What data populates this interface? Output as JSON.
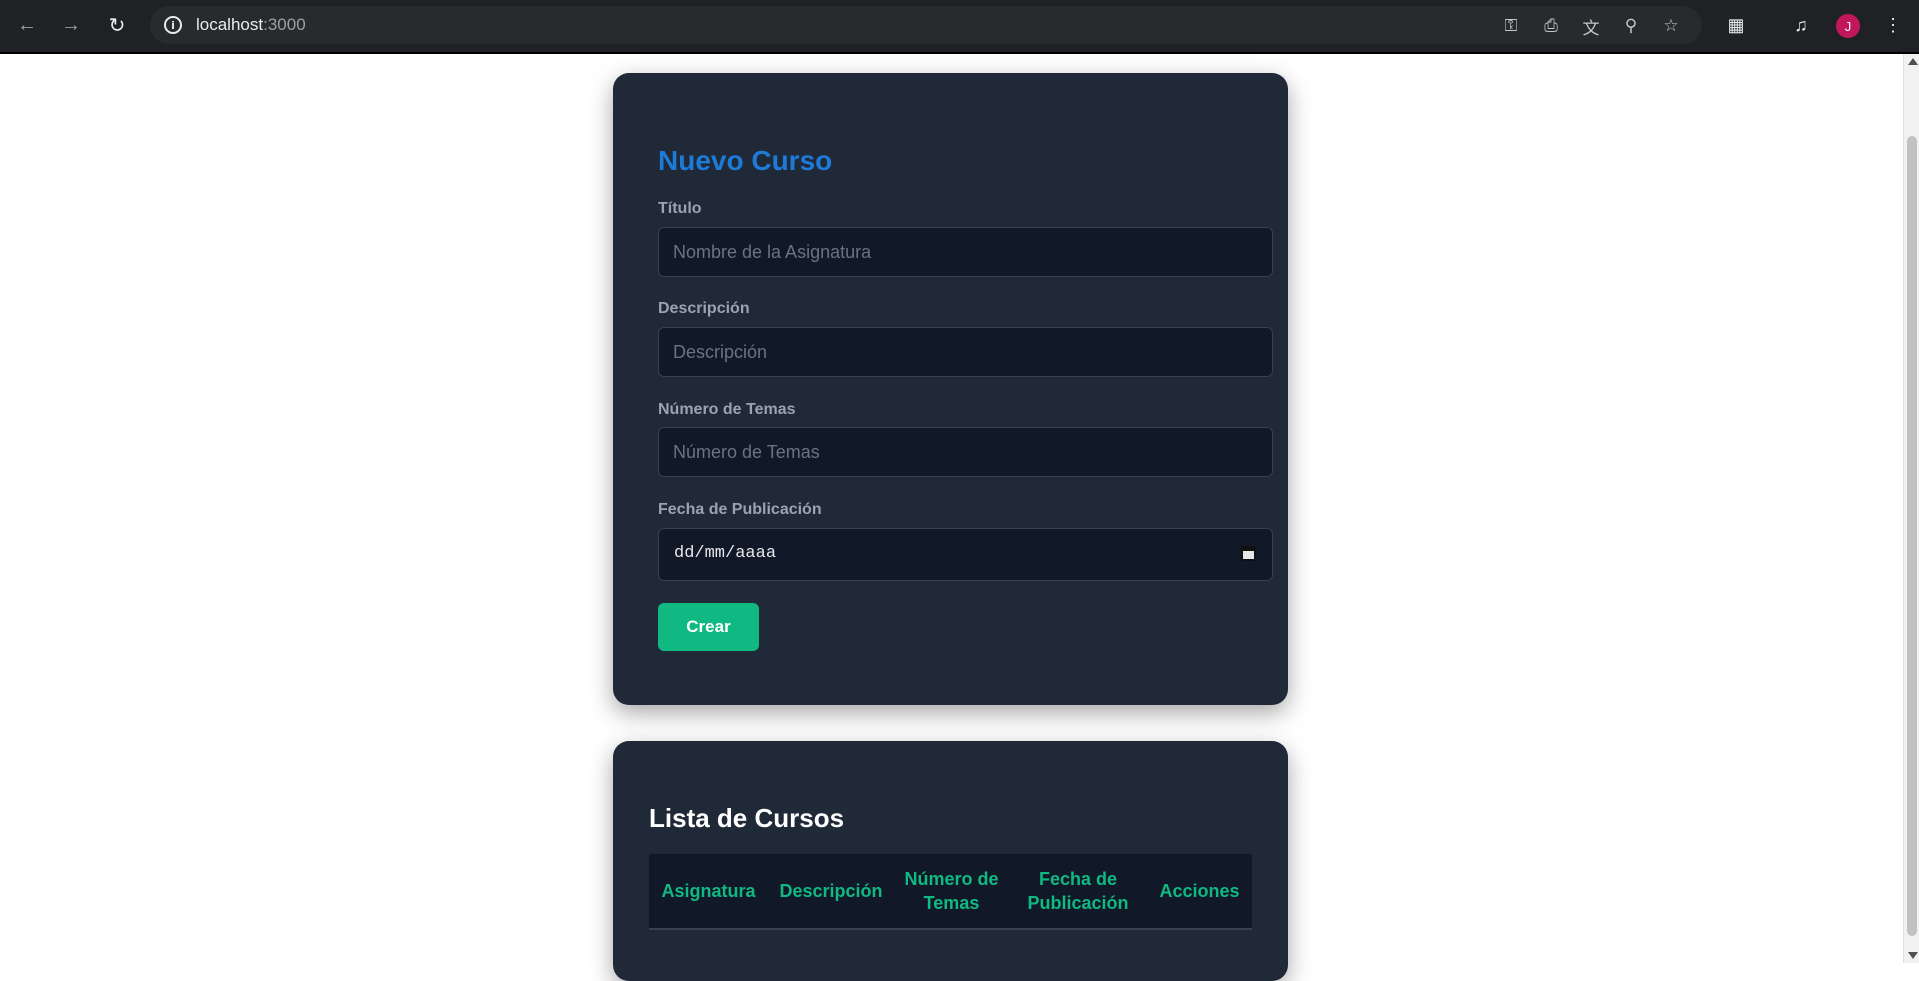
{
  "browser": {
    "url_host": "localhost",
    "url_port": ":3000",
    "avatar_initial": "J"
  },
  "form": {
    "title": "Nuevo Curso",
    "fields": [
      {
        "label": "Título",
        "placeholder": "Nombre de la Asignatura",
        "value": ""
      },
      {
        "label": "Descripción",
        "placeholder": "Descripción",
        "value": ""
      },
      {
        "label": "Número de Temas",
        "placeholder": "Número de Temas",
        "value": ""
      },
      {
        "label": "Fecha de Publicación",
        "placeholder": "dd/mm/aaaa",
        "value": ""
      }
    ],
    "submit_label": "Crear"
  },
  "list": {
    "title": "Lista de Cursos",
    "columns": [
      "Asignatura",
      "Descripción",
      "Número de Temas",
      "Fecha de Publicación",
      "Acciones"
    ]
  },
  "colors": {
    "card_bg": "#1f2937",
    "accent_blue": "#1e7ad8",
    "accent_green": "#10b981"
  }
}
